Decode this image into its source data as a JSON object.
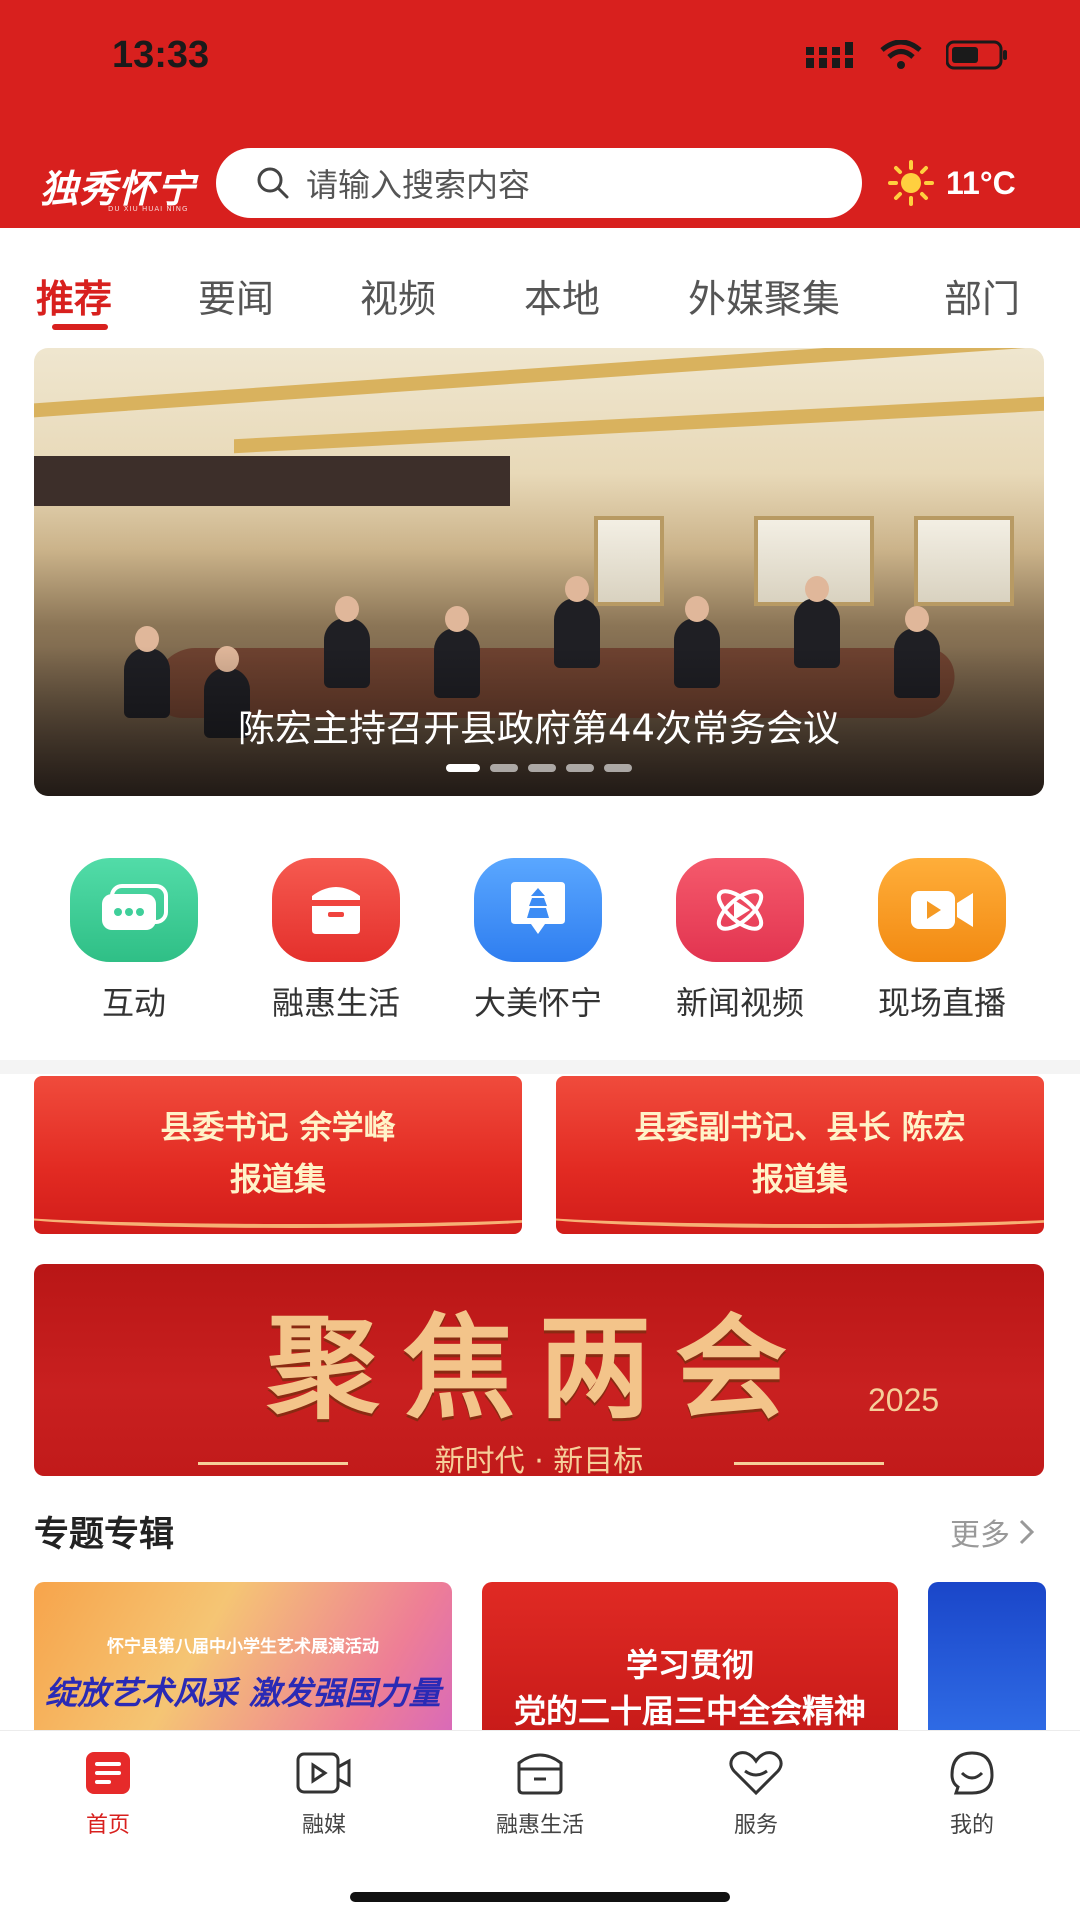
{
  "status_bar": {
    "time": "13:33"
  },
  "header": {
    "logo_text": "独秀怀宁",
    "logo_subtext": "DU XIU HUAI NING",
    "search_placeholder": "请输入搜索内容",
    "weather_temp": "11°C",
    "weather_icon": "sun-icon"
  },
  "tabs": [
    "推荐",
    "要闻",
    "视频",
    "本地",
    "外媒聚集",
    "部门"
  ],
  "active_tab": 0,
  "banner": {
    "caption": "陈宏主持召开县政府第44次常务会议",
    "slides": 5,
    "active_slide": 0
  },
  "quick_links": [
    {
      "label": "互动",
      "icon": "chat-bubble-icon",
      "color": "#3fcf9a"
    },
    {
      "label": "融惠生活",
      "icon": "box-icon",
      "color": "#f0443e"
    },
    {
      "label": "大美怀宁",
      "icon": "pagoda-icon",
      "color": "#3d8cf4"
    },
    {
      "label": "新闻视频",
      "icon": "play-orbit-icon",
      "color": "#ef4458"
    },
    {
      "label": "现场直播",
      "icon": "video-camera-icon",
      "color": "#f59a23"
    }
  ],
  "reports": [
    {
      "line1": "县委书记 余学峰",
      "line2": "报道集"
    },
    {
      "line1": "县委副书记、县长 陈宏",
      "line2": "报道集"
    }
  ],
  "sessions_banner": {
    "title": "聚焦两会",
    "year": "2025",
    "slogan": "新时代 · 新目标"
  },
  "section": {
    "title": "专题专辑",
    "more": "更多"
  },
  "topics": [
    {
      "line1": "怀宁县第八届中小学生艺术展演活动",
      "line2": "绽放艺术风采 激发强国力量"
    },
    {
      "line1": "学习贯彻",
      "line2": "党的二十届三中全会精神"
    },
    {
      "line1": ""
    }
  ],
  "bottom_nav": [
    {
      "label": "首页",
      "icon": "news-icon"
    },
    {
      "label": "融媒",
      "icon": "video-play-icon"
    },
    {
      "label": "融惠生活",
      "icon": "box-icon"
    },
    {
      "label": "服务",
      "icon": "heart-icon"
    },
    {
      "label": "我的",
      "icon": "profile-face-icon"
    }
  ],
  "active_nav": 0,
  "colors": {
    "brand_red": "#d8201e"
  }
}
